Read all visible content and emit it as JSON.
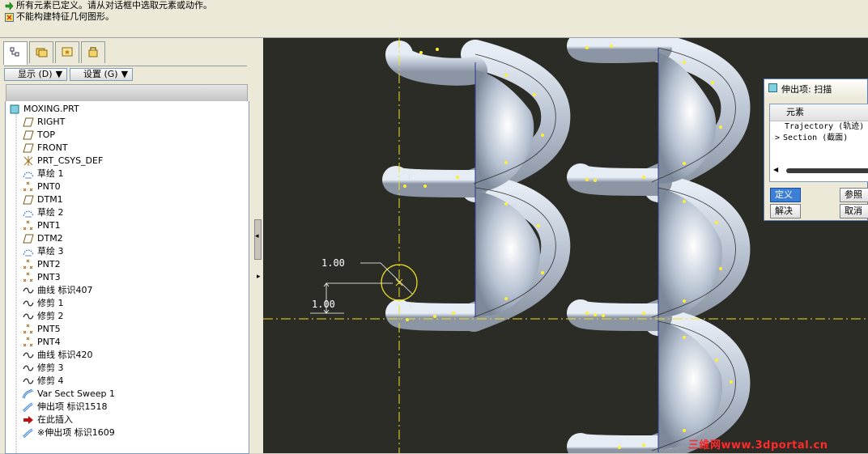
{
  "messages": [
    {
      "text": "所有元素已定义。请从对话框中选取元素或动作。",
      "icon": "green-arrow-icon"
    },
    {
      "text": "不能构建特征几何图形。",
      "icon": "warning-icon"
    }
  ],
  "panel": {
    "tabs": [
      {
        "name": "model-tree-tab",
        "icon": "model-tree-icon"
      },
      {
        "name": "folder-browser-tab",
        "icon": "folder-icon"
      },
      {
        "name": "favorites-tab",
        "icon": "favorites-icon"
      },
      {
        "name": "connections-tab",
        "icon": "connections-icon"
      }
    ],
    "show_button": "显示 (D)",
    "settings_button": "设置 (G)"
  },
  "tree": {
    "root": "MOXING.PRT",
    "items": [
      {
        "label": "RIGHT",
        "icon": "datum-plane-icon"
      },
      {
        "label": "TOP",
        "icon": "datum-plane-icon"
      },
      {
        "label": "FRONT",
        "icon": "datum-plane-icon"
      },
      {
        "label": "PRT_CSYS_DEF",
        "icon": "csys-icon"
      },
      {
        "label": "草绘 1",
        "icon": "sketch-icon"
      },
      {
        "label": "PNT0",
        "icon": "datum-point-icon"
      },
      {
        "label": "DTM1",
        "icon": "datum-plane-icon"
      },
      {
        "label": "草绘 2",
        "icon": "sketch-icon"
      },
      {
        "label": "PNT1",
        "icon": "datum-point-icon"
      },
      {
        "label": "DTM2",
        "icon": "datum-plane-icon"
      },
      {
        "label": "草绘 3",
        "icon": "sketch-icon"
      },
      {
        "label": "PNT2",
        "icon": "datum-point-icon"
      },
      {
        "label": "PNT3",
        "icon": "datum-point-icon"
      },
      {
        "label": "曲线 标识407",
        "icon": "curve-icon"
      },
      {
        "label": "修剪 1",
        "icon": "curve-icon"
      },
      {
        "label": "修剪 2",
        "icon": "curve-icon"
      },
      {
        "label": "PNT5",
        "icon": "datum-point-icon"
      },
      {
        "label": "PNT4",
        "icon": "datum-point-icon"
      },
      {
        "label": "曲线 标识420",
        "icon": "curve-icon"
      },
      {
        "label": "修剪 3",
        "icon": "curve-icon"
      },
      {
        "label": "修剪 4",
        "icon": "curve-icon"
      },
      {
        "label": "Var Sect Sweep 1",
        "icon": "var-sect-sweep-icon"
      },
      {
        "label": "伸出项 标识1518",
        "icon": "protrusion-icon"
      },
      {
        "label": "在此插入",
        "icon": "insert-here-icon"
      },
      {
        "label": "※伸出项 标识1609",
        "icon": "protrusion-icon"
      }
    ]
  },
  "viewport": {
    "dim1": "1.00",
    "dim2": "1.00"
  },
  "dialog": {
    "title": "伸出项: 扫描",
    "col_header": "元素",
    "rows": [
      "Trajectory (轨迹)",
      "Section (截面)"
    ],
    "buttons": {
      "define": "定义",
      "reference": "参照",
      "resolve": "解决",
      "cancel": "取消"
    }
  },
  "watermark": "三维网www.3dportal.cn",
  "colors": {
    "viewport_bg": "#2c2c27",
    "helix_fill": "#b6c0ce",
    "dim_color": "#ffffff",
    "datum_yellow": "#f0e020",
    "watermark": "#ff2a2a"
  }
}
